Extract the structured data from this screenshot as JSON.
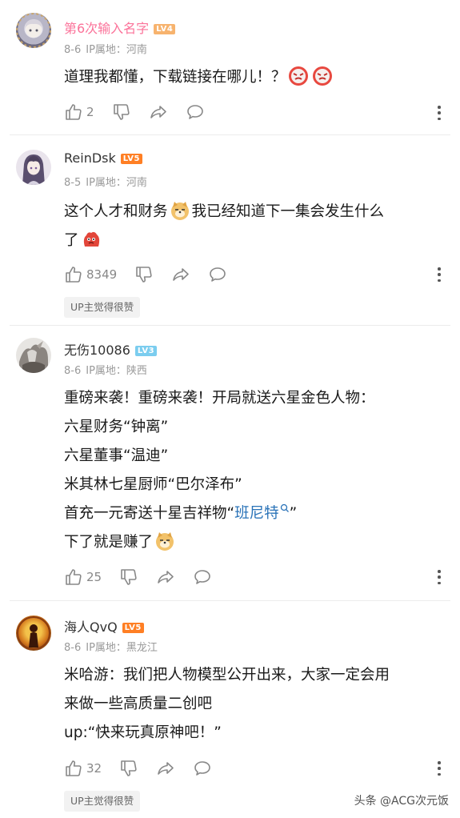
{
  "comments": [
    {
      "username": "第6次输入名字",
      "level": "LV4",
      "level_color": "#f7b36e",
      "username_color": "#fb7299",
      "date": "8-6",
      "ip_label": "IP属地：河南",
      "lines": [
        "道理我都懂，下载链接在哪儿！？"
      ],
      "emojis": [
        "angry-face-emoji",
        "angry-face-emoji"
      ],
      "likes": "2",
      "badge": ""
    },
    {
      "username": "ReinDsk",
      "level": "LV5",
      "level_color": "#ff7f24",
      "username_color": "#333333",
      "date": "8-5",
      "ip_label": "IP属地：河南",
      "line1_a": "这个人才和财务",
      "line1_b": "我已经知道下一集会发生什么",
      "line2": "了",
      "emojis": [
        "doge-emoji",
        "red-blob-emoji"
      ],
      "likes": "8349",
      "badge": "UP主觉得很赞"
    },
    {
      "username": "无伤10086",
      "level": "LV3",
      "level_color": "#7bcdef",
      "username_color": "#333333",
      "date": "8-6",
      "ip_label": "IP属地：陕西",
      "lines": [
        "重磅来袭！重磅来袭！开局就送六星金色人物：",
        "六星财务“钟离”",
        "六星董事“温迪”",
        "米其林七星厨师“巴尔泽布”"
      ],
      "line5_a": "首充一元寄送十星吉祥物“",
      "line5_link": "班尼特",
      "line5_b": "”",
      "line6": "下了就是赚了",
      "emojis": [
        "search-icon",
        "doge-emoji"
      ],
      "likes": "25",
      "badge": ""
    },
    {
      "username": "海人QvQ",
      "level": "LV5",
      "level_color": "#ff7f24",
      "username_color": "#333333",
      "date": "8-6",
      "ip_label": "IP属地：黑龙江",
      "lines": [
        "米哈游：我们把人物模型公开出来，大家一定会用",
        "来做一些高质量二创吧",
        "up:“快来玩真原神吧！”"
      ],
      "likes": "32",
      "badge": "UP主觉得很赞"
    }
  ],
  "icons": [
    "thumb-up-icon",
    "thumb-down-icon",
    "share-icon",
    "reply-icon",
    "more-icon"
  ],
  "watermark": "头条 @ACG次元饭"
}
